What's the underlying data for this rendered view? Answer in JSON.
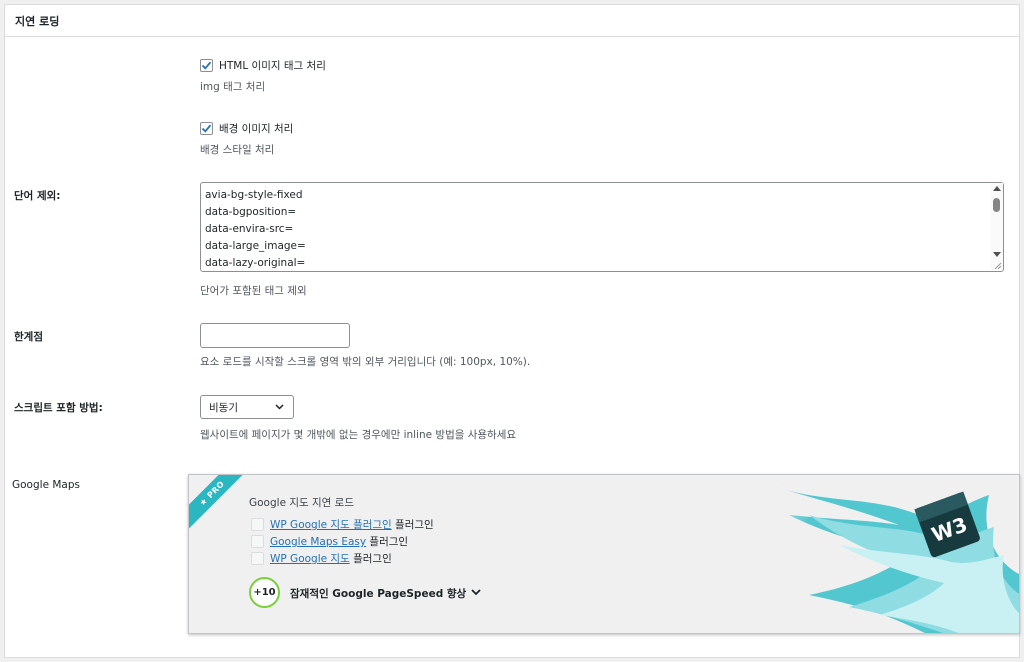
{
  "panel": {
    "title": "지연 로딩"
  },
  "html_images": {
    "label": "HTML 이미지 태그 처리",
    "checked": true,
    "desc": "img 태그 처리"
  },
  "bg_images": {
    "label": "배경 이미지 처리",
    "checked": true,
    "desc": "배경 스타일 처리"
  },
  "exclude": {
    "label": "단어 제외:",
    "lines": [
      "avia-bg-style-fixed",
      "data-bgposition=",
      "data-envira-src=",
      "data-large_image=",
      "data-lazy-original="
    ],
    "desc": "단어가 포함된 태그 제외"
  },
  "threshold": {
    "label": "한계점",
    "value": "",
    "desc": "요소 로드를 시작할 스크롤 영역 밖의 외부 거리입니다 (예: 100px, 10%)."
  },
  "script_embed": {
    "label": "스크립트 포함 방법:",
    "selected": "비동기",
    "desc": "웹사이트에 페이지가 몇 개밖에 없는 경우에만 inline 방법을 사용하세요"
  },
  "google_maps": {
    "label": "Google Maps",
    "ribbon": "★ PRO",
    "title": "Google 지도 지연 로드",
    "plugins": [
      {
        "link": "WP Google 지도 플러그인",
        "suffix": " 플러그인"
      },
      {
        "link": "Google Maps Easy",
        "suffix": " 플러그인"
      },
      {
        "link": "WP Google 지도",
        "suffix": " 플러그인"
      }
    ],
    "score": "+10",
    "score_text": "잠재적인 Google PageSpeed 향상",
    "logo_text": "W3"
  },
  "colors": {
    "accent": "#2271b1",
    "ribbon": "#2ab7c2",
    "score_ring": "#7ad03a"
  }
}
